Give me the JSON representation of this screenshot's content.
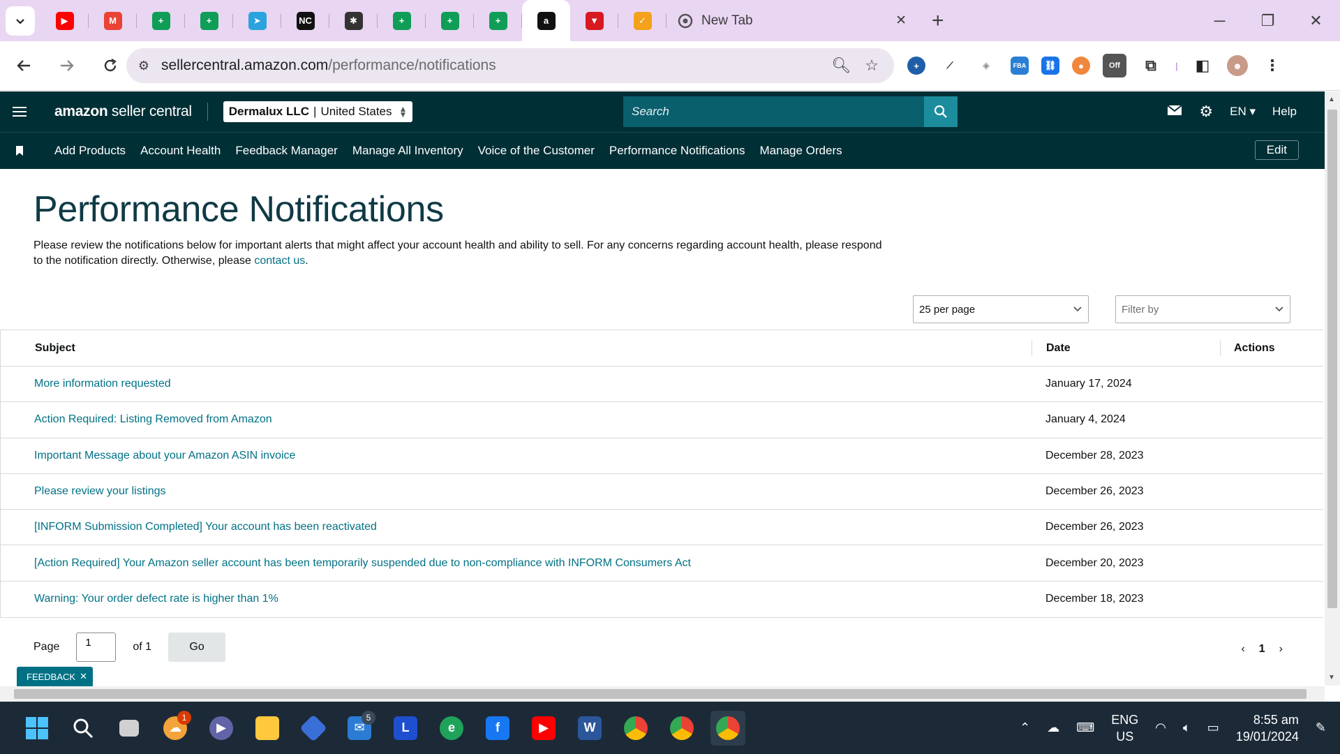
{
  "browser": {
    "pinned_tabs": [
      {
        "icon": "youtube-icon",
        "glyph": "▶",
        "color": "#ff0000"
      },
      {
        "icon": "gmail-icon",
        "glyph": "M",
        "color": "#ea4335"
      },
      {
        "icon": "sheets-icon",
        "glyph": "+",
        "color": "#0f9d58"
      },
      {
        "icon": "sheets-icon",
        "glyph": "+",
        "color": "#0f9d58"
      },
      {
        "icon": "telegram-icon",
        "glyph": "➤",
        "color": "#2aa3df"
      },
      {
        "icon": "nc-icon",
        "glyph": "NC",
        "color": "#111111"
      },
      {
        "icon": "dark-app-icon",
        "glyph": "✱",
        "color": "#333333"
      },
      {
        "icon": "sheets-icon",
        "glyph": "+",
        "color": "#0f9d58"
      },
      {
        "icon": "sheets-icon",
        "glyph": "+",
        "color": "#0f9d58"
      },
      {
        "icon": "sheets-icon",
        "glyph": "+",
        "color": "#0f9d58"
      },
      {
        "icon": "amazon-icon",
        "glyph": "a",
        "color": "#111111",
        "active": true
      },
      {
        "icon": "red-triangle-icon",
        "glyph": "▼",
        "color": "#d71920"
      },
      {
        "icon": "tasks-icon",
        "glyph": "✓",
        "color": "#f4a21b"
      }
    ],
    "active_tab_title": "New Tab",
    "url_domain": "sellercentral.amazon.com",
    "url_path": "/performance/notifications"
  },
  "header": {
    "logo_bold": "amazon",
    "logo_rest": " seller central",
    "account_name": "Dermalux LLC",
    "account_region": "United States",
    "search_placeholder": "Search",
    "language": "EN",
    "help": "Help"
  },
  "nav": {
    "links": [
      "Add Products",
      "Account Health",
      "Feedback Manager",
      "Manage All Inventory",
      "Voice of the Customer",
      "Performance Notifications",
      "Manage Orders"
    ],
    "edit": "Edit"
  },
  "page": {
    "title": "Performance Notifications",
    "intro": "Please review the notifications below for important alerts that might affect your account health and ability to sell. For any concerns regarding account health, please respond to the notification directly. Otherwise, please ",
    "intro_link": "contact us",
    "intro_end": ".",
    "per_page": "25 per page",
    "filter_placeholder": "Filter by"
  },
  "table": {
    "headers": {
      "subject": "Subject",
      "date": "Date",
      "actions": "Actions"
    },
    "rows": [
      {
        "subject": "More information requested",
        "date": "January 17, 2024"
      },
      {
        "subject": "Action Required: Listing Removed from Amazon",
        "date": "January 4, 2024"
      },
      {
        "subject": "Important Message about your Amazon ASIN invoice",
        "date": "December 28, 2023"
      },
      {
        "subject": "Please review your listings",
        "date": "December 26, 2023"
      },
      {
        "subject": "[INFORM Submission Completed] Your account has been reactivated",
        "date": "December 26, 2023"
      },
      {
        "subject": "[Action Required] Your Amazon seller account has been temporarily suspended due to non-compliance with INFORM Consumers Act",
        "date": "December 20, 2023"
      },
      {
        "subject": "Warning: Your order defect rate is higher than 1%",
        "date": "December 18, 2023"
      }
    ]
  },
  "pagination": {
    "page_label": "Page",
    "page_value": "1",
    "of_label": "of 1",
    "go": "Go",
    "current": "1"
  },
  "feedback": "FEEDBACK",
  "taskbar": {
    "outlook_badge": "1",
    "mail_badge": "5",
    "lang_top": "ENG",
    "lang_bottom": "US",
    "time": "8:55 am",
    "date": "19/01/2024"
  },
  "colors": {
    "sc_dark": "#002f36",
    "link": "#007185",
    "tab_strip": "#e9d6f2"
  }
}
